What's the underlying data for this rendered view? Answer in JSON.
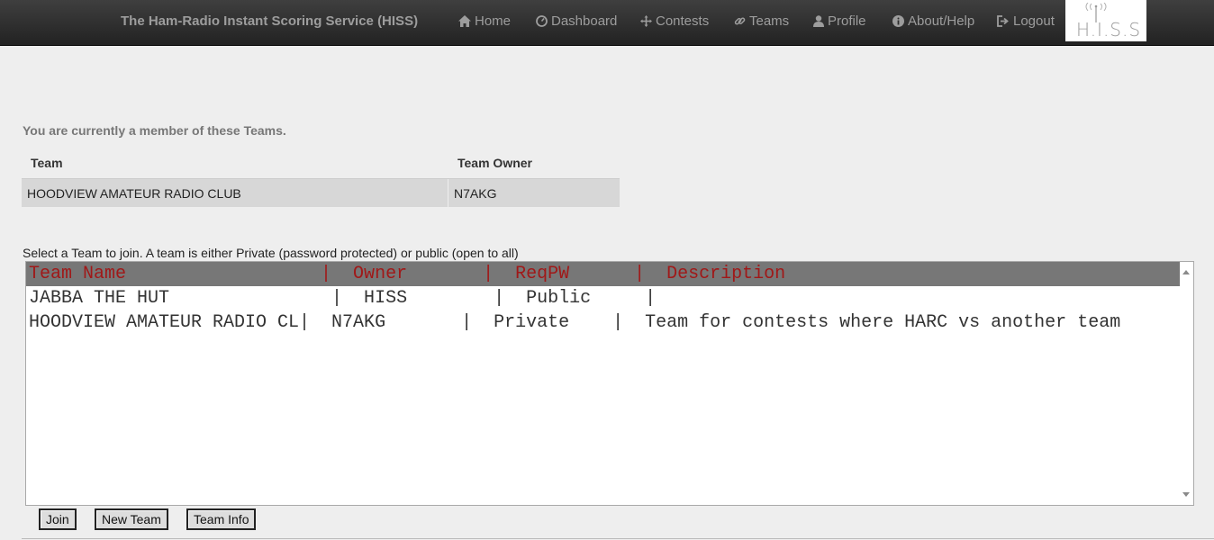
{
  "navbar": {
    "brand": "The Ham-Radio Instant Scoring Service (HISS)",
    "items": [
      {
        "label": "Home",
        "icon": "home-icon"
      },
      {
        "label": "Dashboard",
        "icon": "dashboard-icon"
      },
      {
        "label": "Contests",
        "icon": "move-icon"
      },
      {
        "label": "Teams",
        "icon": "link-icon"
      },
      {
        "label": "Profile",
        "icon": "user-icon"
      },
      {
        "label": "About/Help",
        "icon": "info-icon"
      },
      {
        "label": "Logout",
        "icon": "logout-icon"
      }
    ],
    "logo_text": "H.I.S.S"
  },
  "membership": {
    "note": "You are currently a member of these Teams.",
    "columns": [
      "Team",
      "Team Owner"
    ],
    "rows": [
      {
        "team": "HOODVIEW AMATEUR RADIO CLUB",
        "owner": "N7AKG"
      }
    ]
  },
  "join": {
    "note": "Select a Team to join. A team is either Private (password protected) or public (open to all)",
    "header": "Team Name                  |  Owner       |  ReqPW      |  Description",
    "rows": [
      "JABBA THE HUT               |  HISS        |  Public     |",
      "HOODVIEW AMATEUR RADIO CL|  N7AKG       |  Private    |  Team for contests where HARC vs another team"
    ]
  },
  "buttons": {
    "join": "Join",
    "new_team": "New Team",
    "team_info": "Team Info"
  },
  "colors": {
    "navbar": "#222222",
    "listbox_header_bg": "#777777",
    "listbox_header_text": "#a01818",
    "row_highlight": "#d7d7d7"
  }
}
